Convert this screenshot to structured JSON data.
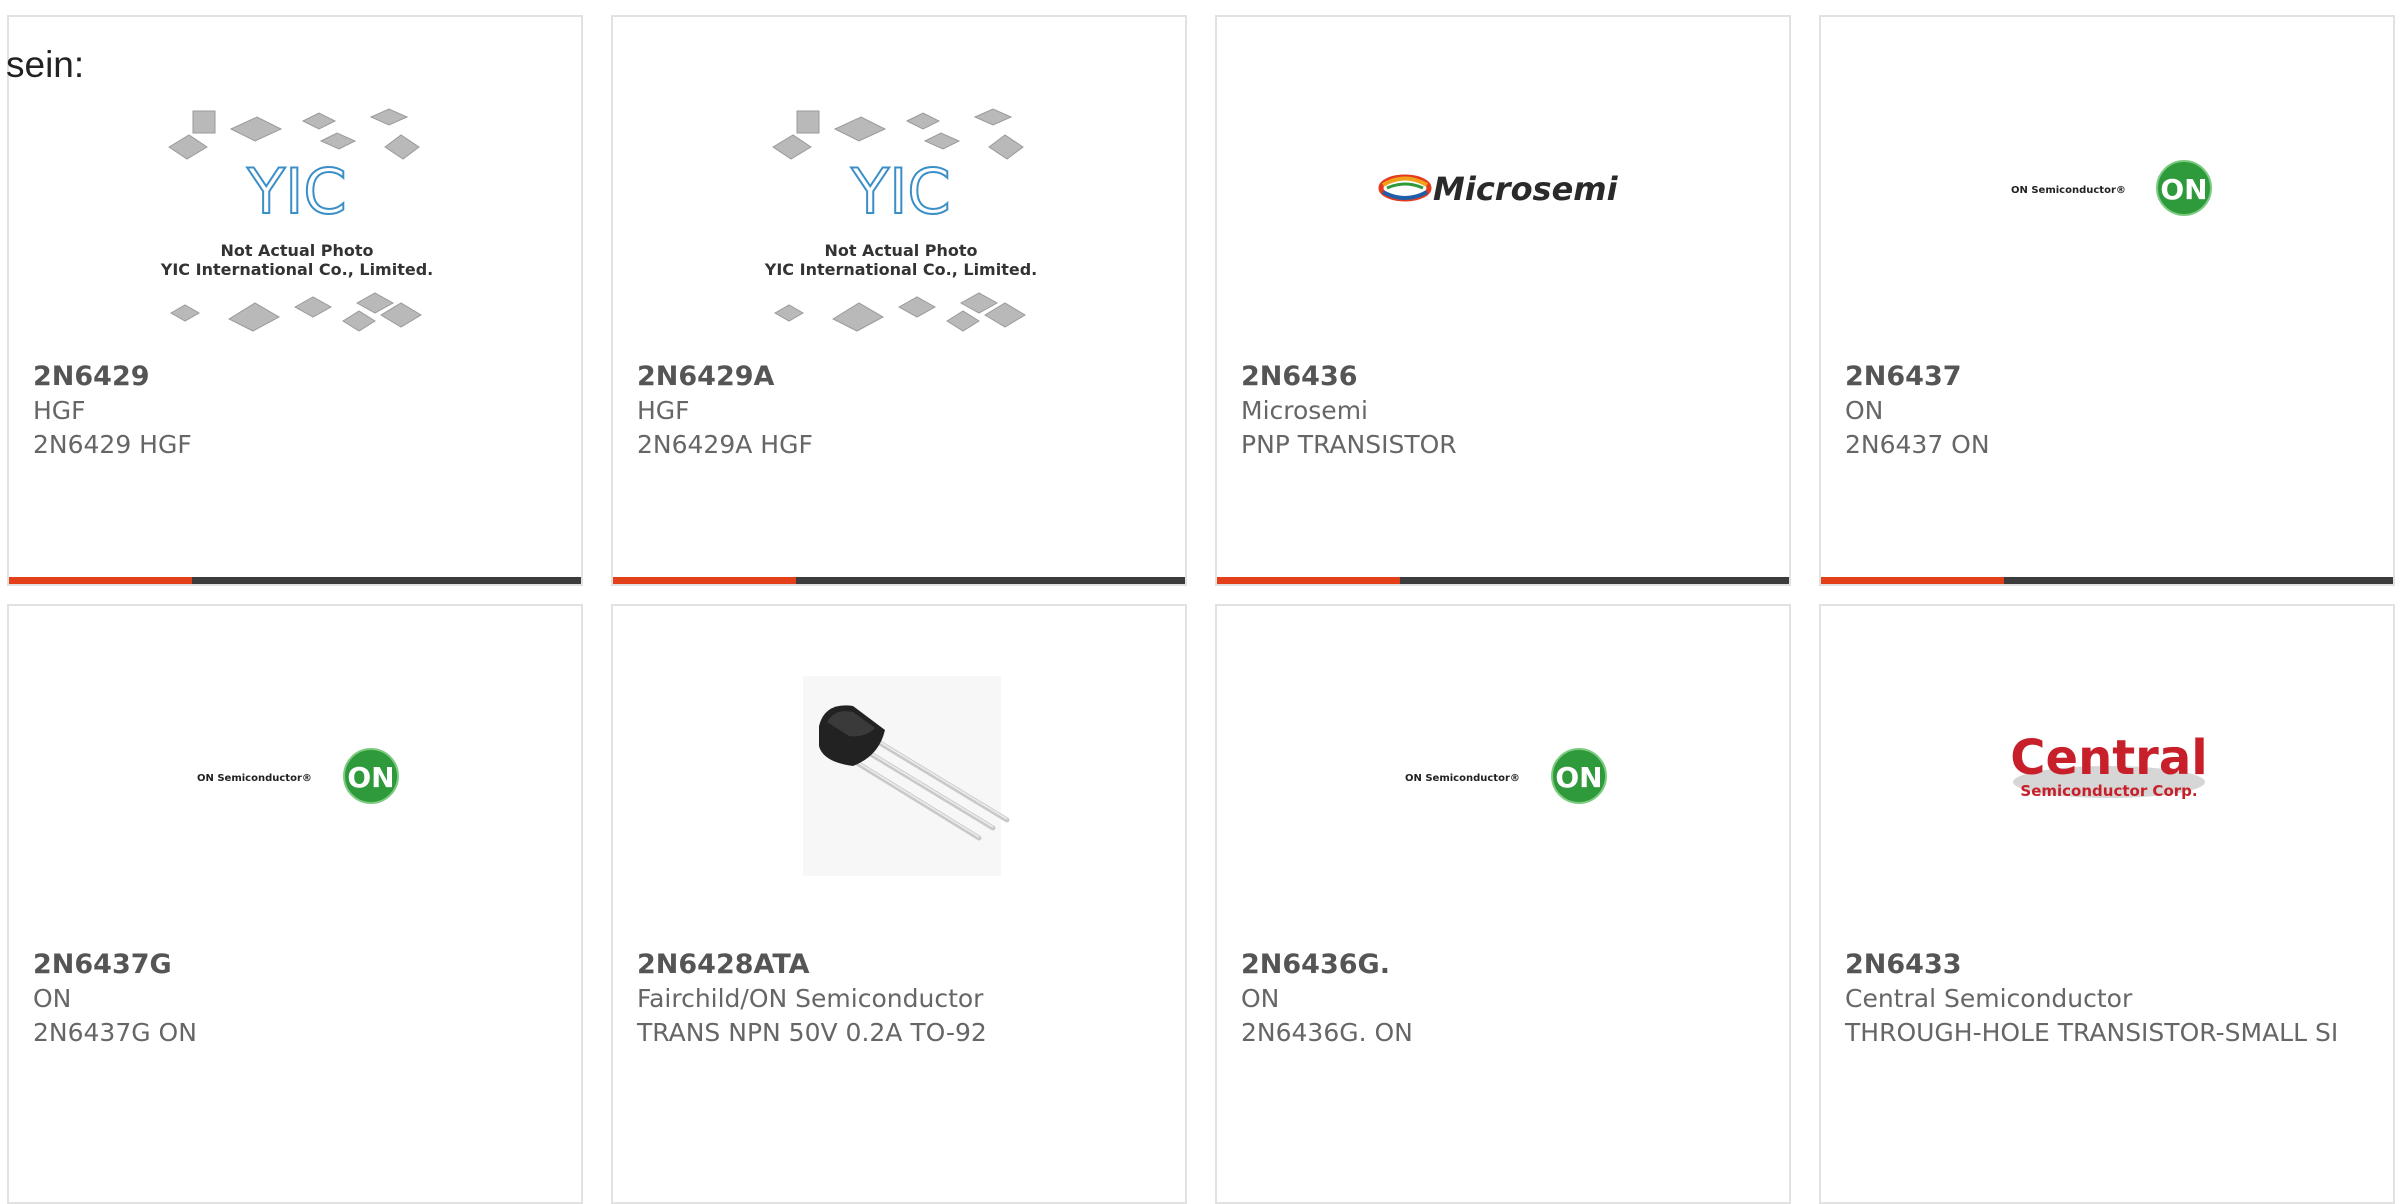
{
  "intro_text": "sein:",
  "products": [
    {
      "part": "2N6429",
      "manufacturer": "HGF",
      "description": "2N6429 HGF",
      "image": "yic-placeholder-photo",
      "image_caption_1": "Not Actual Photo",
      "image_caption_2": "YIC International Co., Limited."
    },
    {
      "part": "2N6429A",
      "manufacturer": "HGF",
      "description": "2N6429A HGF",
      "image": "yic-placeholder-photo",
      "image_caption_1": "Not Actual Photo",
      "image_caption_2": "YIC International Co., Limited."
    },
    {
      "part": "2N6436",
      "manufacturer": "Microsemi",
      "description": "PNP TRANSISTOR",
      "image": "microsemi-logo",
      "logo_text": "Microsemi"
    },
    {
      "part": "2N6437",
      "manufacturer": "ON",
      "description": "2N6437 ON",
      "image": "on-semiconductor-logo",
      "logo_text": "ON Semiconductor®",
      "logo_badge": "ON"
    },
    {
      "part": "2N6437G",
      "manufacturer": "ON",
      "description": "2N6437G ON",
      "image": "on-semiconductor-logo",
      "logo_text": "ON Semiconductor®",
      "logo_badge": "ON"
    },
    {
      "part": "2N6428ATA",
      "manufacturer": "Fairchild/ON Semiconductor",
      "description": "TRANS NPN 50V 0.2A TO-92",
      "image": "to92-transistor-photo"
    },
    {
      "part": "2N6436G.",
      "manufacturer": "ON",
      "description": "2N6436G. ON",
      "image": "on-semiconductor-logo",
      "logo_text": "ON Semiconductor®",
      "logo_badge": "ON"
    },
    {
      "part": "2N6433",
      "manufacturer": "Central Semiconductor",
      "description": "THROUGH-HOLE TRANSISTOR-SMALL SI",
      "image": "central-semiconductor-logo",
      "logo_text": "Central",
      "logo_subtext": "Semiconductor Corp."
    }
  ],
  "colors": {
    "accent": "#e3401a",
    "bar": "#3c3c3c",
    "on_green": "#2e9a3c",
    "central_red": "#c8202a",
    "text": "#666666"
  }
}
